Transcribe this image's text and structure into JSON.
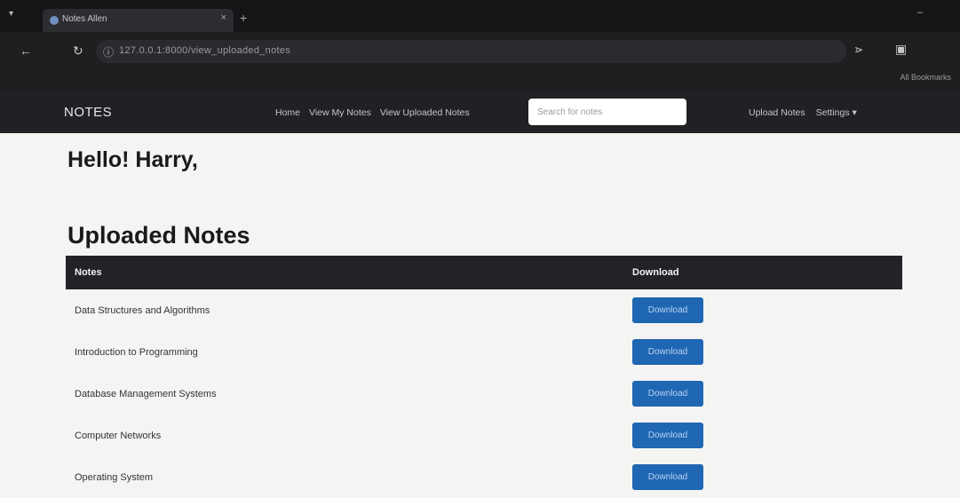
{
  "browser": {
    "tab_title": "Notes Allen",
    "tab_close": "×",
    "new_tab": "+",
    "url": "127.0.0.1:8000/view_uploaded_notes",
    "bookmarks": "All Bookmarks",
    "icons": [
      "menu-icon",
      "back-arrow-icon",
      "reload-icon",
      "info-icon",
      "extensions-icon",
      "sidebar-icon",
      "minimize-icon"
    ]
  },
  "navbar": {
    "brand": "NOTES",
    "links": [
      "Home",
      "View My Notes",
      "View Uploaded Notes"
    ],
    "search_placeholder": "Search for notes",
    "right_links": [
      "Upload Notes",
      "Settings ▾"
    ]
  },
  "page": {
    "greeting": "Hello! Harry,",
    "section_title": "Uploaded Notes"
  },
  "table": {
    "columns": [
      "Notes",
      "Download"
    ],
    "rows": [
      {
        "title": "Data Structures and Algorithms",
        "action": "Download"
      },
      {
        "title": "Introduction to Programming",
        "action": "Download"
      },
      {
        "title": "Database Management Systems",
        "action": "Download"
      },
      {
        "title": "Computer Networks",
        "action": "Download"
      },
      {
        "title": "Operating System",
        "action": "Download"
      }
    ]
  },
  "colors": {
    "navbar_bg": "#202124",
    "table_header_bg": "#222326",
    "button_bg": "#1f66b3"
  }
}
